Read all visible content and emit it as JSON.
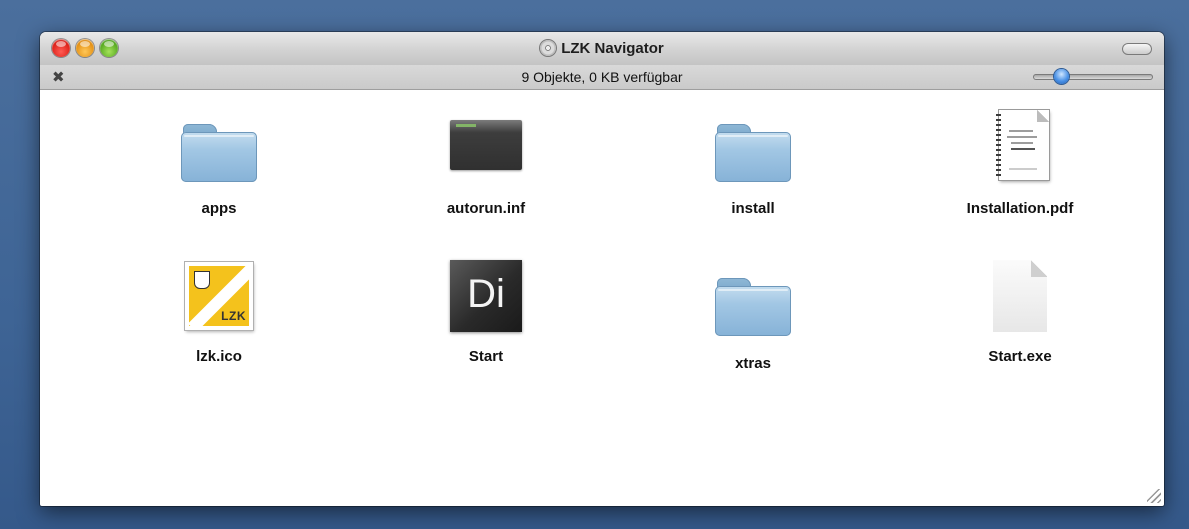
{
  "window": {
    "title": "LZK Navigator",
    "status": "9 Objekte, 0 KB verfügbar"
  },
  "items": [
    {
      "label": "apps",
      "icon": "folder-icon"
    },
    {
      "label": "autorun.inf",
      "icon": "inf-file-icon"
    },
    {
      "label": "install",
      "icon": "folder-icon"
    },
    {
      "label": "Installation.pdf",
      "icon": "pdf-document-icon"
    },
    {
      "label": "lzk.ico",
      "icon": "lzk-ico-icon"
    },
    {
      "label": "Start",
      "icon": "director-app-icon",
      "glyph": "Di"
    },
    {
      "label": "xtras",
      "icon": "folder-icon"
    },
    {
      "label": "Start.exe",
      "icon": "blank-document-icon"
    }
  ],
  "colors": {
    "desktop": "#3e6495",
    "folder": "#a2c7e4",
    "slider_knob": "#4b92e6"
  },
  "icon_size_slider": 0.2
}
